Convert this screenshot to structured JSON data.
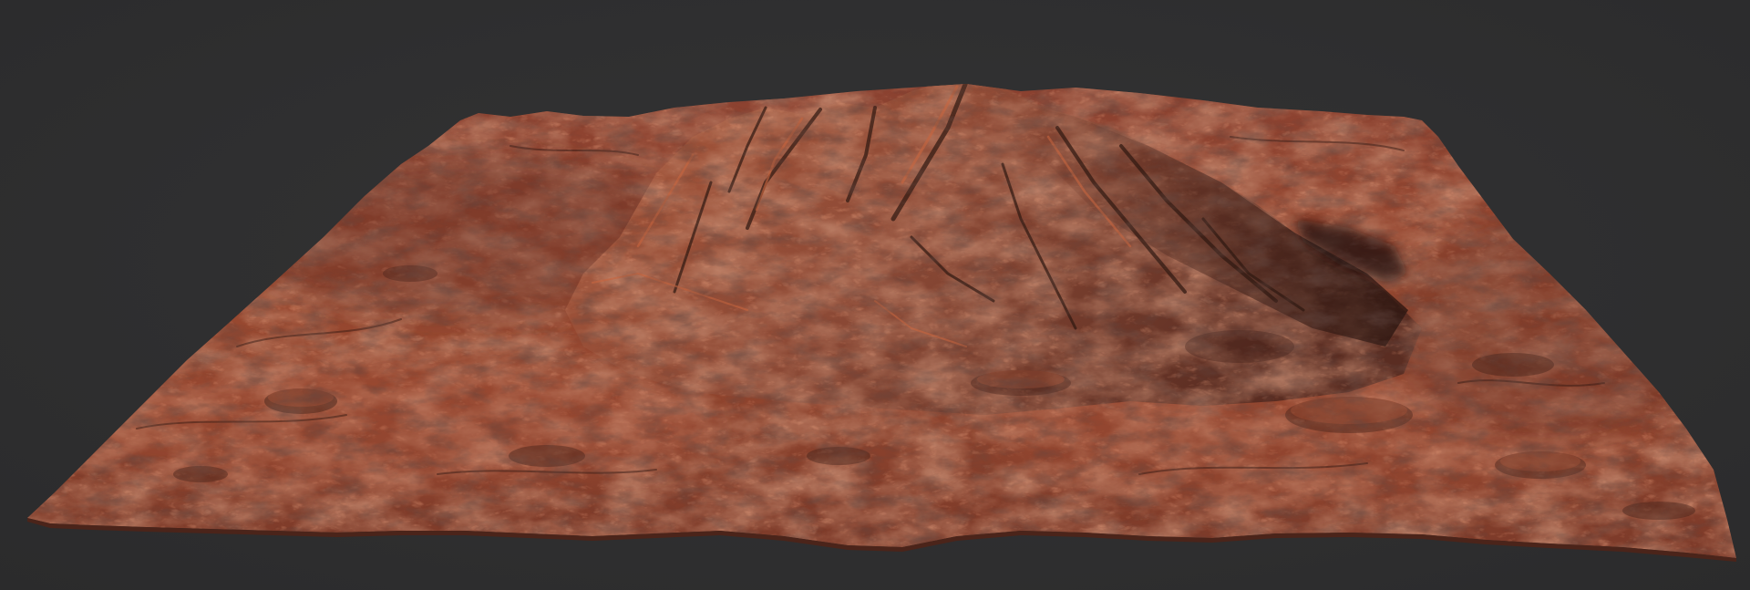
{
  "scene": {
    "background_color": "#2f2f30",
    "subject": "terrain-mesh",
    "colors": {
      "terrain_base": "#9a4a30",
      "terrain_highlight": "#d2603a",
      "terrain_shadow": "#3a1f17",
      "terrain_mid": "#7a3a27"
    }
  }
}
